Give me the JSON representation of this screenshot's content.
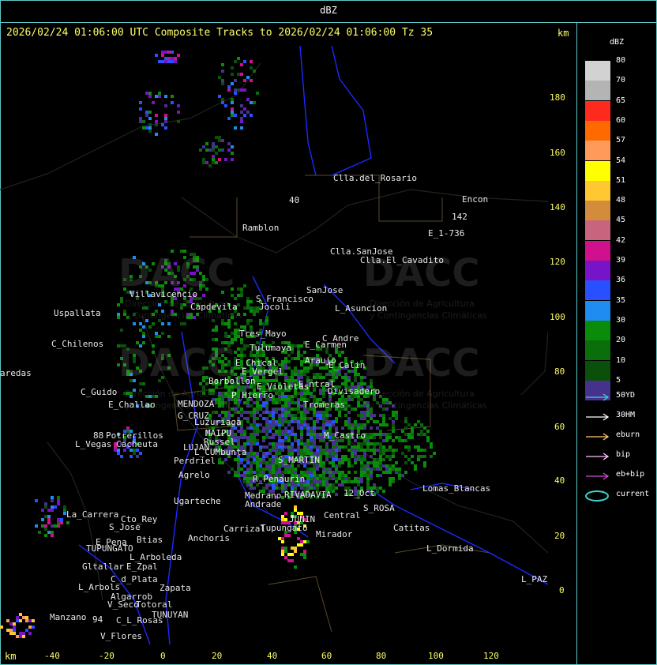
{
  "header": {
    "title": "dBZ"
  },
  "banner": {
    "time_text": "2026/02/24 01:06:00 UTC Composite Tracks to 2026/02/24 01:06:00 Tz 35"
  },
  "axes": {
    "unit_top": "km",
    "unit_bottom": "km",
    "y_ticks": [
      "180",
      "160",
      "140",
      "120",
      "100",
      "80",
      "60",
      "40",
      "20",
      "0"
    ],
    "x_ticks": [
      "-40",
      "-20",
      "0",
      "20",
      "40",
      "60",
      "80",
      "100",
      "120"
    ]
  },
  "watermark": {
    "brand": "DACC",
    "subtitle_1": "Dirección de Agricultura",
    "subtitle_2": "y Contingencias Climáticas"
  },
  "places": [
    {
      "id": "clla-del-rosario",
      "label": "Clla.del_Rosario"
    },
    {
      "id": "encon",
      "label": "Encon"
    },
    {
      "id": "r142",
      "label": "142"
    },
    {
      "id": "e1736",
      "label": "E_1-736"
    },
    {
      "id": "ramblon",
      "label": "Ramblon"
    },
    {
      "id": "r40",
      "label": "40"
    },
    {
      "id": "clla-sanjose",
      "label": "Clla.SanJose"
    },
    {
      "id": "clla-el-cavadito",
      "label": "Clla.El_Cavadito"
    },
    {
      "id": "villavicencio",
      "label": "Villavicencio"
    },
    {
      "id": "s-francisco",
      "label": "S_Francisco"
    },
    {
      "id": "sanjose",
      "label": "SanJose"
    },
    {
      "id": "capdevila",
      "label": "Capdevila"
    },
    {
      "id": "jocoli",
      "label": "Jocoli"
    },
    {
      "id": "l-asuncion",
      "label": "L_Asuncion"
    },
    {
      "id": "uspallata",
      "label": "Uspallata"
    },
    {
      "id": "tres-mayo",
      "label": "Tres_Mayo"
    },
    {
      "id": "c-andre",
      "label": "C_Andre"
    },
    {
      "id": "c-chilenos",
      "label": "C_Chilenos"
    },
    {
      "id": "tulumaya",
      "label": "Tulumaya"
    },
    {
      "id": "e-carmen",
      "label": "E_Carmen"
    },
    {
      "id": "e-chical",
      "label": "E_Chical"
    },
    {
      "id": "araujo",
      "label": "Araujo"
    },
    {
      "id": "e-calin",
      "label": "E_Calin"
    },
    {
      "id": "e-vergel",
      "label": "E_Vergel"
    },
    {
      "id": "aredas",
      "label": "aredas"
    },
    {
      "id": "borbollon",
      "label": "Borbollon"
    },
    {
      "id": "e-violetas",
      "label": "E_Violetas"
    },
    {
      "id": "e-ntral",
      "label": "E_ntral"
    },
    {
      "id": "c-guido",
      "label": "C_Guido"
    },
    {
      "id": "p-hierro",
      "label": "P_Hierro"
    },
    {
      "id": "divisadero",
      "label": "Divisadero"
    },
    {
      "id": "mendoza",
      "label": "MENDOZA"
    },
    {
      "id": "e-challao",
      "label": "E_Challao"
    },
    {
      "id": "tromeras",
      "label": "Tromeras"
    },
    {
      "id": "g-cruz",
      "label": "G_CRUZ"
    },
    {
      "id": "luzuriaga",
      "label": "Luzuriaga"
    },
    {
      "id": "maipu",
      "label": "MAIPU"
    },
    {
      "id": "m-castro",
      "label": "M_Castro"
    },
    {
      "id": "potrerillos",
      "label": "Potrerillos"
    },
    {
      "id": "r88",
      "label": "88"
    },
    {
      "id": "russel",
      "label": "Russel"
    },
    {
      "id": "l-vegas",
      "label": "L_Vegas"
    },
    {
      "id": "cacheuta",
      "label": "Cacheuta"
    },
    {
      "id": "lujan",
      "label": "LUJAN"
    },
    {
      "id": "l-cumbunta",
      "label": "L_CUMbunta"
    },
    {
      "id": "s-martin",
      "label": "S_MARTIN"
    },
    {
      "id": "perdriel",
      "label": "Perdriel"
    },
    {
      "id": "agrelo",
      "label": "Agrelo"
    },
    {
      "id": "r-penaurin",
      "label": "R_Penaurin"
    },
    {
      "id": "ugarteche",
      "label": "Ugarteche"
    },
    {
      "id": "rivadavia",
      "label": "RIVADAVIA"
    },
    {
      "id": "m12-oct",
      "label": "12_Oct"
    },
    {
      "id": "lomas-blancas",
      "label": "Lomas_Blancas"
    },
    {
      "id": "medrano",
      "label": "Medrano"
    },
    {
      "id": "andrade",
      "label": "Andrade"
    },
    {
      "id": "la-carrera",
      "label": "La_Carrera"
    },
    {
      "id": "cto-rey",
      "label": "Cto_Rey"
    },
    {
      "id": "s-rosa",
      "label": "S_ROSA"
    },
    {
      "id": "s-jose",
      "label": "S_Jose"
    },
    {
      "id": "junin",
      "label": "JUNIN"
    },
    {
      "id": "tupungato-lo",
      "label": "Tupungato"
    },
    {
      "id": "central",
      "label": "Central"
    },
    {
      "id": "catitas",
      "label": "Catitas"
    },
    {
      "id": "carrizal",
      "label": "Carrizal"
    },
    {
      "id": "btias",
      "label": "Btias"
    },
    {
      "id": "anchoris",
      "label": "Anchoris"
    },
    {
      "id": "mirador",
      "label": "Mirador"
    },
    {
      "id": "e-pena",
      "label": "E_Pena"
    },
    {
      "id": "tupungato",
      "label": "TUPUNGATO"
    },
    {
      "id": "l-dormida",
      "label": "L_Dormida"
    },
    {
      "id": "l-arboleda",
      "label": "L_Arboleda"
    },
    {
      "id": "gltallar",
      "label": "Gltallar"
    },
    {
      "id": "e-zpal",
      "label": "E_Zpal"
    },
    {
      "id": "c-d-plata",
      "label": "C_d_Plata"
    },
    {
      "id": "l-paz",
      "label": "L_PAZ"
    },
    {
      "id": "l-arbols",
      "label": "L_Arbols"
    },
    {
      "id": "zapata",
      "label": "Zapata"
    },
    {
      "id": "algarrob",
      "label": "Algarrob"
    },
    {
      "id": "v-seco",
      "label": "V_Seco"
    },
    {
      "id": "totoral",
      "label": "Totoral"
    },
    {
      "id": "tunuyan",
      "label": "TUNUYAN"
    },
    {
      "id": "manzano",
      "label": "Manzano"
    },
    {
      "id": "r94",
      "label": "94"
    },
    {
      "id": "c-l-rosas",
      "label": "C_L_Rosas"
    },
    {
      "id": "v-flores",
      "label": "V_Flores"
    }
  ],
  "legend": {
    "title": "dBZ",
    "scale": [
      {
        "label": "80",
        "color": "#d2d2d2"
      },
      {
        "label": "70",
        "color": "#b4b4b4"
      },
      {
        "label": "65",
        "color": "#ff2a1e"
      },
      {
        "label": "60",
        "color": "#ff6a00"
      },
      {
        "label": "57",
        "color": "#ff9a5a"
      },
      {
        "label": "54",
        "color": "#ffff00"
      },
      {
        "label": "51",
        "color": "#ffc832"
      },
      {
        "label": "48",
        "color": "#d28c3c"
      },
      {
        "label": "45",
        "color": "#c8647e"
      },
      {
        "label": "42",
        "color": "#d0108c"
      },
      {
        "label": "39",
        "color": "#7814c8"
      },
      {
        "label": "36",
        "color": "#2850ff"
      },
      {
        "label": "35",
        "color": "#1e8cf0"
      },
      {
        "label": "30",
        "color": "#0a8c0a"
      },
      {
        "label": "20",
        "color": "#0a6e0a"
      },
      {
        "label": "10",
        "color": "#0a500a"
      },
      {
        "label": "5",
        "color": "#46328c"
      }
    ],
    "tracks": [
      {
        "label": "50YD",
        "color": "#3cd2d2",
        "type": "arrow"
      },
      {
        "label": "30HM",
        "color": "#ffffff",
        "type": "arrow"
      },
      {
        "label": "eburn",
        "color": "#ffc878",
        "type": "arrow"
      },
      {
        "label": "bip",
        "color": "#ffc8ff",
        "type": "arrow"
      },
      {
        "label": "eb+bip",
        "color": "#d250d2",
        "type": "arrow"
      },
      {
        "label": "current",
        "color": "#3cd2d2",
        "type": "ellipse"
      }
    ]
  }
}
